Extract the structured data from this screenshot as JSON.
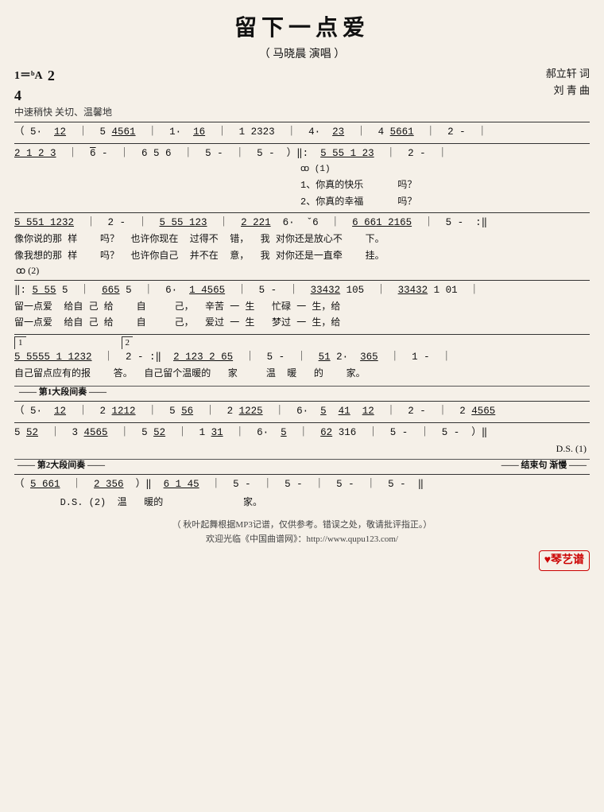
{
  "title": "留下一点爱",
  "subtitle": "（ 马晓晨 演唱 ）",
  "key": "1＝ᵇA",
  "time": "2/4",
  "tempo": "中速稍快 关切、温馨地",
  "composer_lyric": "郝立轩 词",
  "composer_music": "刘  青 曲",
  "footer1": "（ 秋叶起舞根据MP3记谱，仅供参考。错误之处，敬请批评指正。）",
  "footer2": "欢迎光临《中国曲谱网》：http://www.qupu123.com/",
  "logo": "♥琴艺谱"
}
